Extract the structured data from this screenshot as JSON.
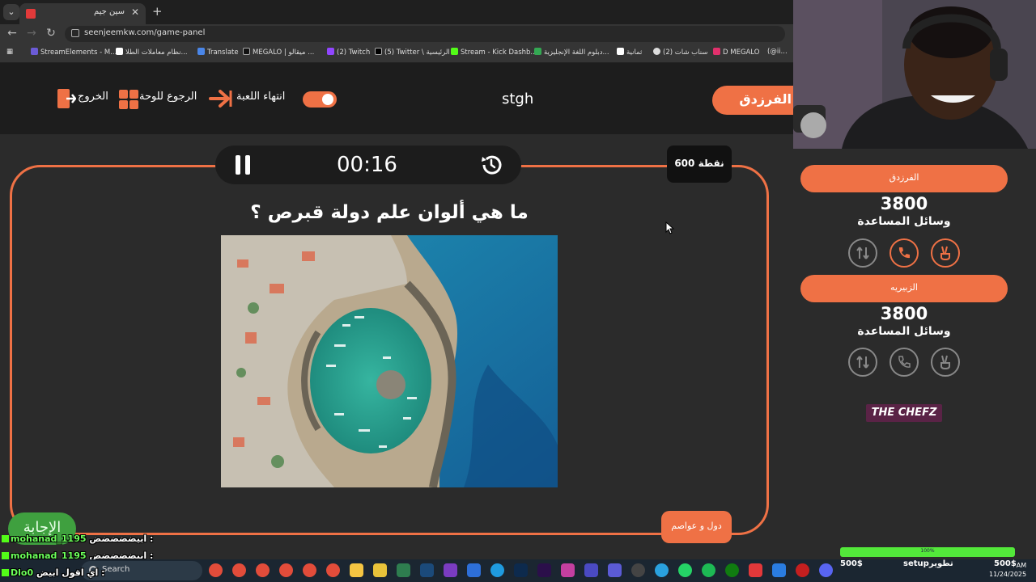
{
  "browser": {
    "tab_title": "سين جيم",
    "url": "seenjeemkw.com/game-panel",
    "bookmarks": [
      "StreamElements - M...",
      "نظام معاملات الطلا...",
      "Translate",
      "MEGALO | ميقالو ...",
      "(2) Twitch",
      "(5) Twitter \\ الرئيسية",
      "Stream - Kick Dashb...",
      "دبلوم اللغة الإنجليزية...",
      "ثمانية",
      "(2) سناب شات",
      "D MEGALO",
      "(@ii..."
    ]
  },
  "header": {
    "current_team": "الفرزدق",
    "session_name": "stgh",
    "end_game_label": "انتهاء اللعبة",
    "back_to_board_label": "الرجوع للوحة",
    "exit_label": "الخروج"
  },
  "game": {
    "timer": "00:16",
    "points": "600 نقطة",
    "question": "ما هي ألوان علم دولة قبرص ؟",
    "category": "دول و عواصم",
    "answer_label": "الإجابة",
    "image_alt": "aerial harbor photo"
  },
  "teams": [
    {
      "name": "الفرزدق",
      "score": "3800",
      "helpers_label": "وسائل المساعدة",
      "helpers_active": [
        true,
        true,
        false
      ]
    },
    {
      "name": "الزبيريه",
      "score": "3800",
      "helpers_label": "وسائل المساعدة",
      "helpers_active": [
        false,
        false,
        false
      ]
    }
  ],
  "brand": "THE CHEFZ",
  "chat": [
    {
      "user": "mohanad_1195",
      "msg": "ابيضضضضض :"
    },
    {
      "user": "mohanad_1195",
      "msg": "ابيضضضضض :"
    },
    {
      "user": "Dlo0",
      "msg": "اي اقول ابيض :"
    }
  ],
  "taskbar": {
    "search_label": "Search",
    "progress_label": "100%",
    "progress_value": 1.0,
    "donation_left": "500$",
    "setup_label": "setup",
    "dev_label": "تطوير",
    "donation_right": "500$",
    "time": "AM",
    "date": "11/24/2025"
  },
  "colors": {
    "accent": "#ef7145",
    "board_bg": "#2b2b2b",
    "header_bg": "#1d1d1d",
    "answer_green": "#3fa03f"
  }
}
